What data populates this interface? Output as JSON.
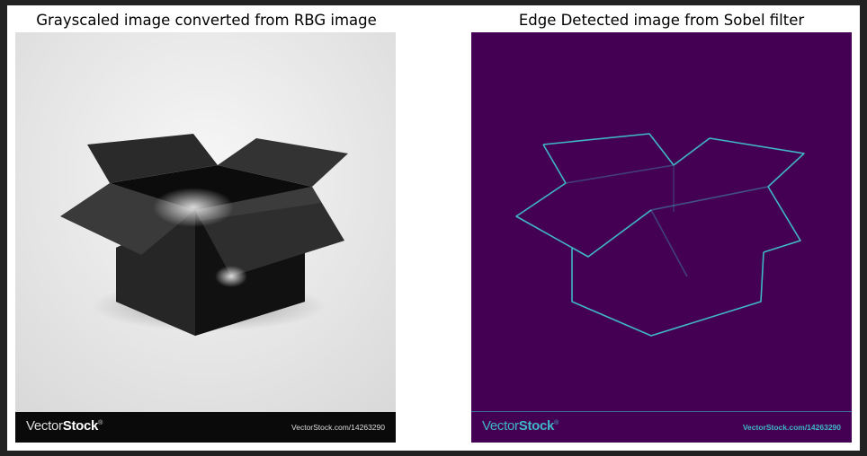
{
  "panels": [
    {
      "title": "Grayscaled image converted from RBG image",
      "watermark": {
        "logo_light": "Vector",
        "logo_bold": "Stock",
        "logo_mark": "®",
        "url": "VectorStock.com/14263290"
      }
    },
    {
      "title": "Edge Detected image from Sobel filter",
      "watermark": {
        "logo_light": "Vector",
        "logo_bold": "Stock",
        "logo_mark": "®",
        "url": "VectorStock.com/14263290"
      }
    }
  ],
  "colors": {
    "window_border": "#222222",
    "figure_background": "#ffffff",
    "edge_background": "#440154",
    "edge_line": "#3fb7c4"
  }
}
